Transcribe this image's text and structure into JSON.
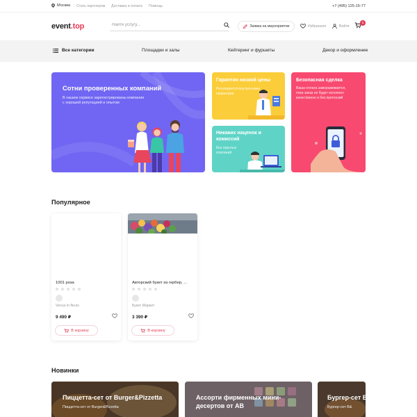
{
  "topbar": {
    "city": "Москва",
    "partners": "Стать партнером",
    "delivery": "Доставка и оплата",
    "help": "Помощь",
    "phone": "+7 (495) 125-15-77"
  },
  "header": {
    "logo_main": "event",
    "logo_dot": ".top",
    "search_placeholder": "Найти услугу...",
    "request_label": "Заявка на мероприятие",
    "favorites": "Избранное",
    "login": "Войти",
    "cart_count": "1"
  },
  "nav": {
    "all": "Все категории",
    "venues": "Площадки и залы",
    "catering": "Кейтеринг и фуршеты",
    "decor": "Декор и оформление"
  },
  "hero": {
    "big_title": "Сотни проверенных компаний",
    "big_text": [
      "В нашем сервисе зарегистрированы компании",
      "с хорошей репутацией и опытом"
    ],
    "guarantee_title": "Гарантия низкой цены",
    "guarantee_text": [
      "Регулируется внутренними",
      "правилами"
    ],
    "nomarkup_title": [
      "Никаких наценок и",
      "комиссий"
    ],
    "nomarkup_text": [
      "Без скрытых",
      "платежей"
    ],
    "safe_title": "Безопасная сделка",
    "safe_text": [
      "Ваша оплата замораживается,",
      "пока заказ не будет исполнен",
      "качественно и без претензий"
    ]
  },
  "popular": {
    "title": "Популярное",
    "products": [
      {
        "name": "1001 роза",
        "vendor": "Venus in fleurs",
        "price": "9 490 ₽",
        "buy": "В корзину"
      },
      {
        "name": "Авторский букет из гербер, ...",
        "vendor": "Букет Маркет",
        "price": "3 390 ₽",
        "buy": "В корзину"
      }
    ]
  },
  "new": {
    "title": "Новинки",
    "items": [
      {
        "title": [
          "Пиццетта-сет от Burger&Pizzetta"
        ],
        "sub": "Пиццетта-сет от Burger&Pizzetta"
      },
      {
        "title": [
          "Ассорти фирменных мини-",
          "десертов от АВ"
        ],
        "sub": ""
      },
      {
        "title": [
          "Бургер-сет В"
        ],
        "sub": "Бургер-сет B&"
      }
    ]
  },
  "colors": {
    "accent": "#e53956",
    "purple": "#7066f3",
    "yellow": "#fbcd3a",
    "teal": "#5fd4c6",
    "pink": "#f84a70"
  }
}
